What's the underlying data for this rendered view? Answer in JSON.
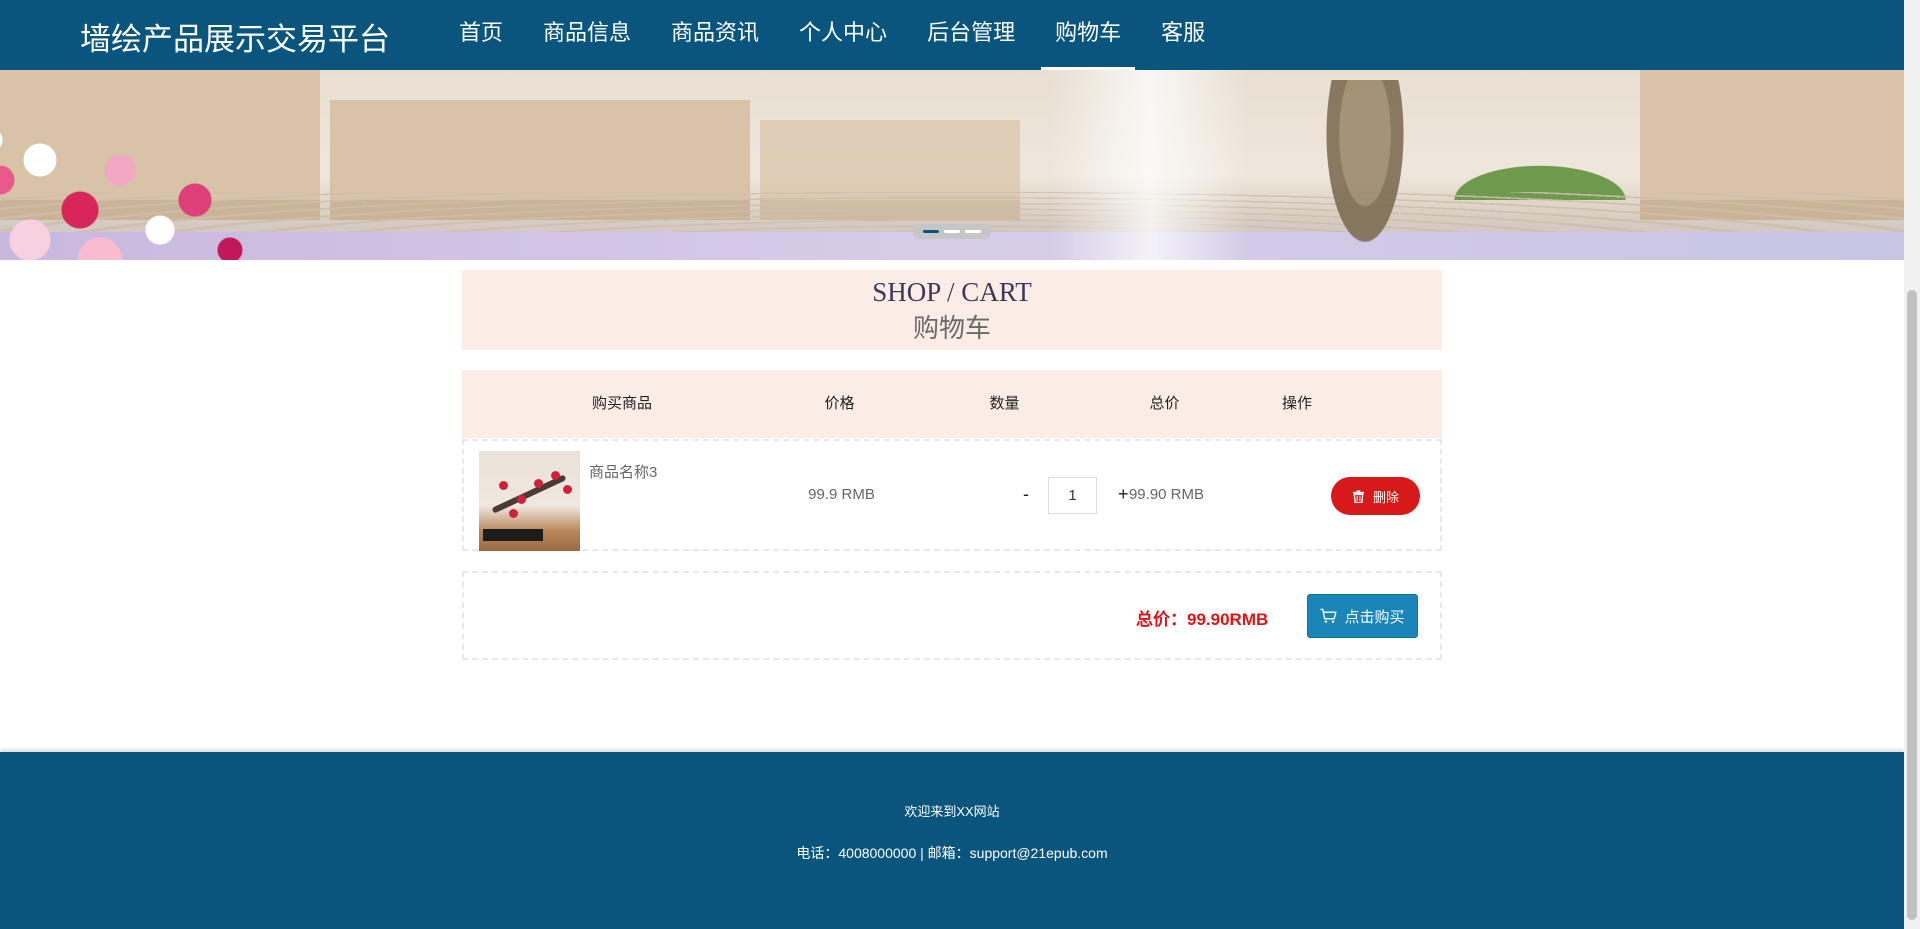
{
  "header": {
    "logo": "墙绘产品展示交易平台",
    "nav": [
      {
        "label": "首页"
      },
      {
        "label": "商品信息"
      },
      {
        "label": "商品资讯"
      },
      {
        "label": "个人中心"
      },
      {
        "label": "后台管理"
      },
      {
        "label": "购物车"
      },
      {
        "label": "客服"
      }
    ],
    "active_nav": "购物车",
    "background_color": "#0a557e"
  },
  "banner": {
    "slide_count": 3,
    "active_slide": 1
  },
  "page_title": {
    "en": "SHOP / CART",
    "cn": "购物车"
  },
  "cart": {
    "columns": [
      "购买商品",
      "价格",
      "数量",
      "总价",
      "操作"
    ],
    "items": [
      {
        "name": "商品名称3",
        "price": "99.9 RMB",
        "quantity": "1",
        "subtotal": "99.90 RMB",
        "image_icon": "plum-blossom-mural-thumbnail",
        "minus_label": "-",
        "plus_label": "+",
        "delete_label": "删除",
        "delete_icon": "trash-icon",
        "delete_color": "#d61a1a"
      }
    ],
    "total_label": "总价：99.90RMB",
    "buy_label": "点击购买",
    "buy_icon": "cart-icon",
    "buy_color": "#1a85b8"
  },
  "footer": {
    "welcome": "欢迎来到XX网站",
    "contact": "电话：4008000000 | 邮箱：support@21epub.com"
  }
}
